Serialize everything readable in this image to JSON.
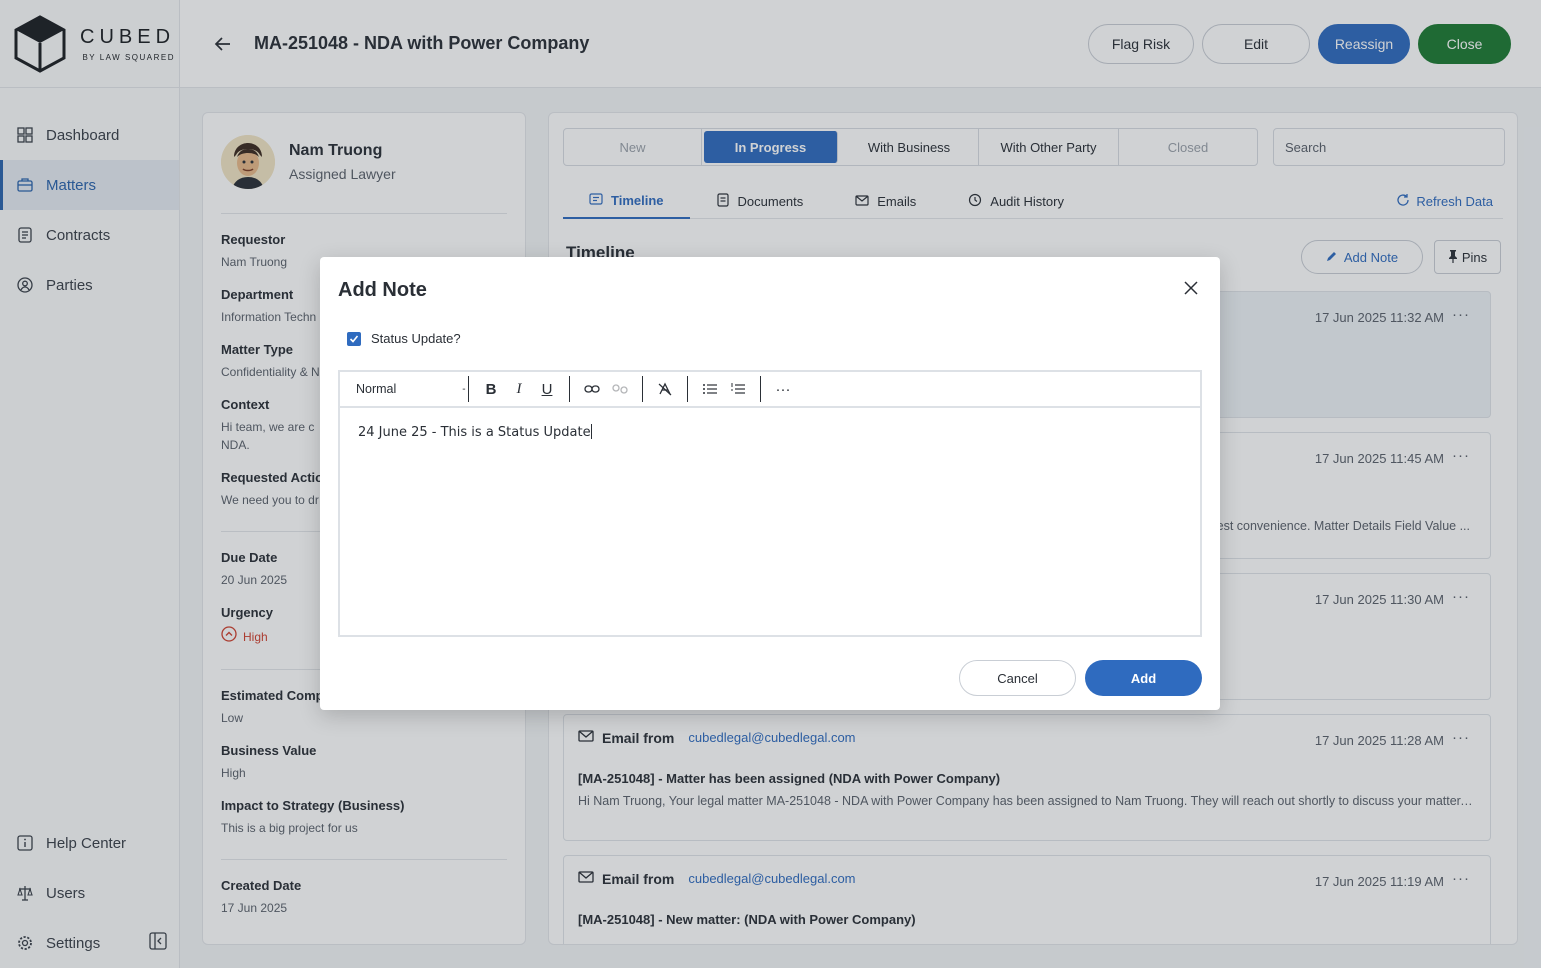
{
  "brand": {
    "name": "CUBED",
    "sub": "BY LAW SQUARED"
  },
  "sidebar": {
    "items": [
      {
        "label": "Dashboard",
        "icon": "dashboard-icon"
      },
      {
        "label": "Matters",
        "icon": "briefcase-icon",
        "active": true
      },
      {
        "label": "Contracts",
        "icon": "document-icon"
      },
      {
        "label": "Parties",
        "icon": "parties-icon"
      }
    ],
    "bottom": [
      {
        "label": "Help Center",
        "icon": "info-icon"
      },
      {
        "label": "Users",
        "icon": "scale-icon"
      },
      {
        "label": "Settings",
        "icon": "gear-icon"
      }
    ]
  },
  "header": {
    "title": "MA-251048 - NDA with Power Company",
    "actions": {
      "flag_risk": "Flag Risk",
      "edit": "Edit",
      "reassign": "Reassign",
      "close": "Close"
    }
  },
  "details": {
    "lawyer_name": "Nam Truong",
    "lawyer_role": "Assigned Lawyer",
    "fields": {
      "requestor": {
        "label": "Requestor",
        "value": "Nam Truong"
      },
      "department": {
        "label": "Department",
        "value": "Information Techn"
      },
      "matter_type": {
        "label": "Matter Type",
        "value": "Confidentiality & N"
      },
      "context": {
        "label": "Context",
        "value_line1": "Hi team, we are c",
        "value_line2": "NDA."
      },
      "requested_action": {
        "label": "Requested Actio",
        "value": "We need you to dr"
      },
      "due_date": {
        "label": "Due Date",
        "value": "20 Jun 2025"
      },
      "urgency": {
        "label": "Urgency",
        "value": "High"
      },
      "complexity": {
        "label": "Estimated Complexity",
        "value": "Low"
      },
      "business_value": {
        "label": "Business Value",
        "value": "High"
      },
      "impact": {
        "label": "Impact to Strategy (Business)",
        "value": "This is a big project for us"
      },
      "created_date": {
        "label": "Created Date",
        "value": "17 Jun 2025"
      }
    }
  },
  "status_tabs": [
    "New",
    "In Progress",
    "With Business",
    "With Other Party",
    "Closed"
  ],
  "search": {
    "placeholder": "Search"
  },
  "view_tabs": {
    "timeline": "Timeline",
    "documents": "Documents",
    "emails": "Emails",
    "audit": "Audit History",
    "refresh": "Refresh Data"
  },
  "timeline": {
    "title": "Timeline",
    "add_note": "Add Note",
    "pins": "Pins",
    "cards": [
      {
        "date": "17 Jun 2025 11:32 AM"
      },
      {
        "date": "17 Jun 2025 11:45 AM",
        "snippet": "est convenience. Matter Details Field Value ..."
      },
      {
        "date": "17 Jun 2025 11:30 AM"
      },
      {
        "date": "17 Jun 2025 11:28 AM",
        "from_label": "Email from",
        "email": "cubedlegal@cubedlegal.com",
        "subject": "[MA-251048] - Matter has been assigned (NDA with Power Company)",
        "body": "Hi Nam Truong, Your legal matter MA-251048 - NDA with Power Company has been assigned to Nam Truong. They will reach out shortly to discuss your matter. Pl..."
      },
      {
        "date": "17 Jun 2025 11:19 AM",
        "from_label": "Email from",
        "email": "cubedlegal@cubedlegal.com",
        "subject": "[MA-251048] - New matter: (NDA with Power Company)"
      }
    ]
  },
  "modal": {
    "title": "Add Note",
    "status_update_label": "Status Update?",
    "status_update_checked": true,
    "format_value": "Normal",
    "content": "24 June 25 - This is a Status Update",
    "cancel": "Cancel",
    "add": "Add"
  },
  "colors": {
    "primary": "#2f6bbf",
    "success": "#1d7a32",
    "danger": "#d0402f"
  }
}
